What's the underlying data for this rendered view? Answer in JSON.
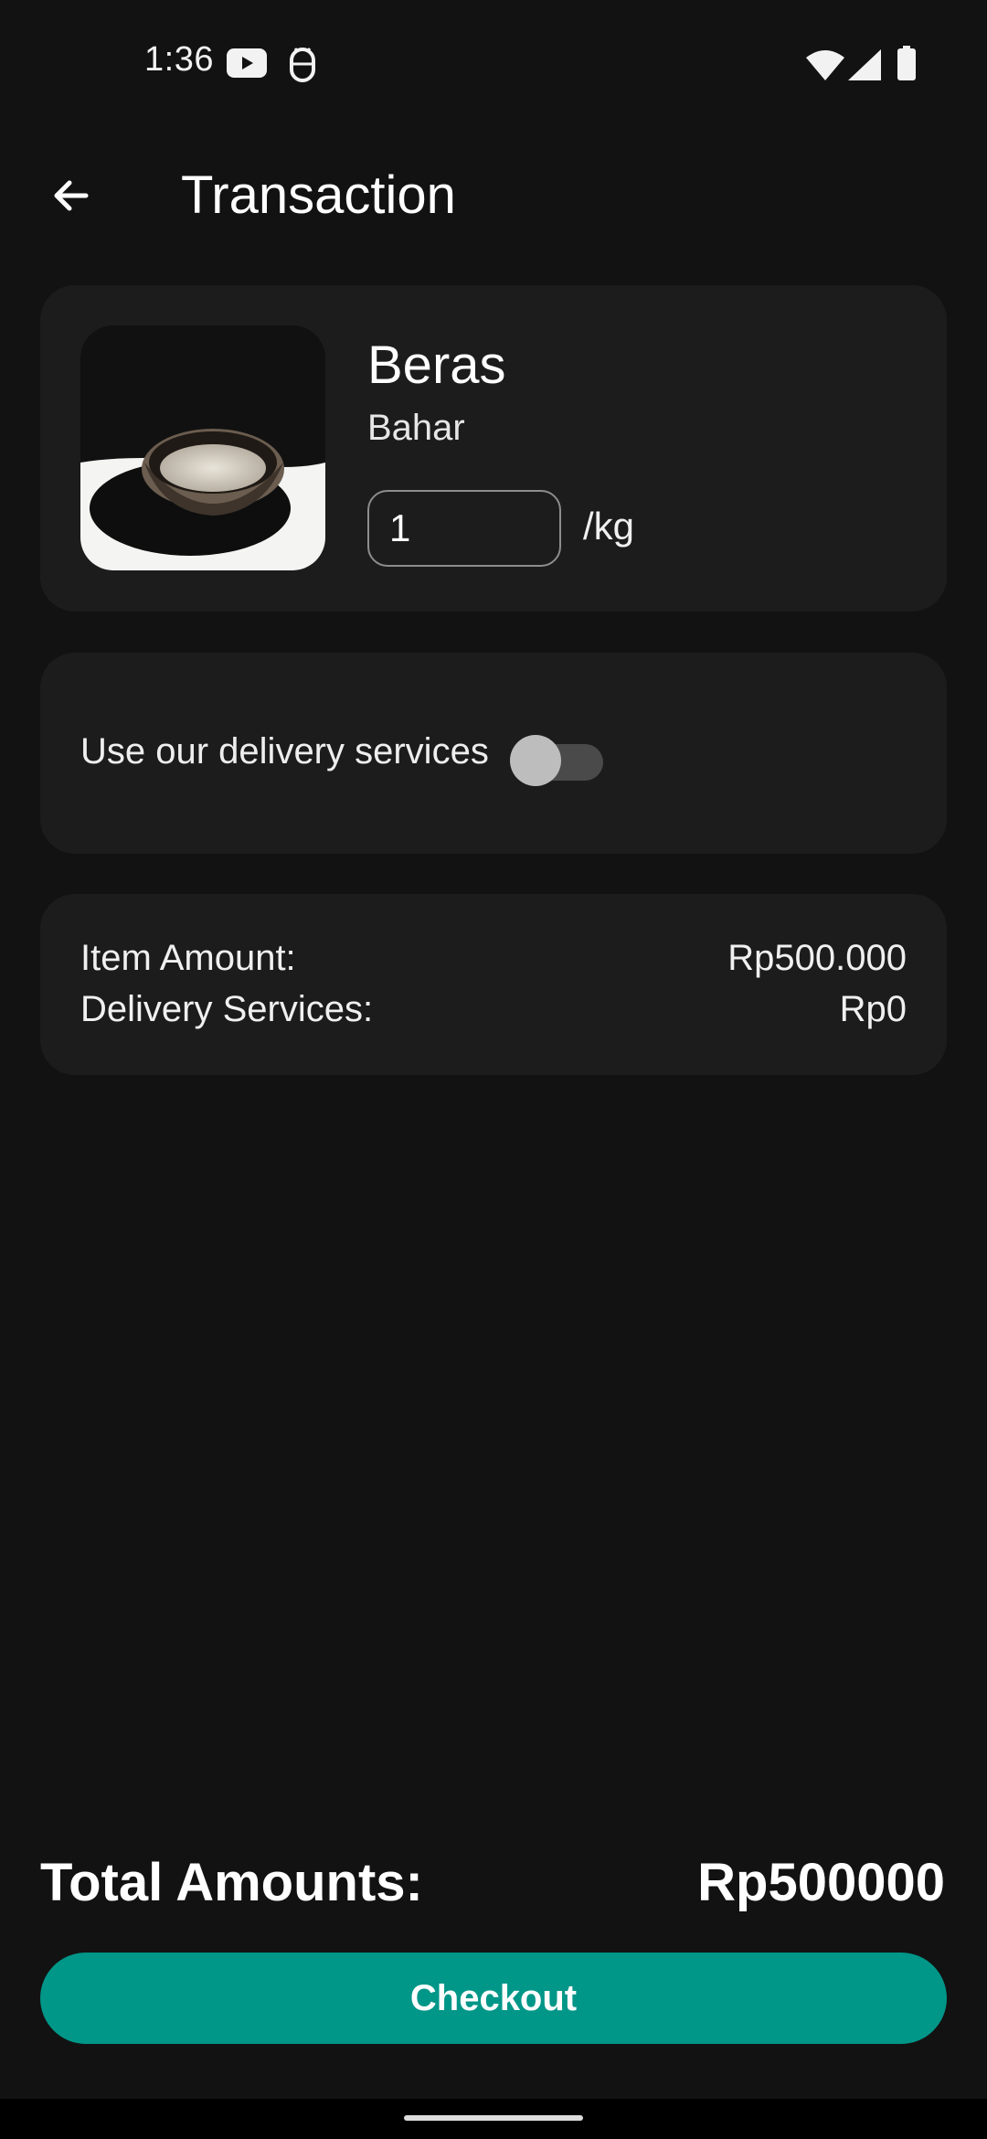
{
  "status_bar": {
    "time": "1:36",
    "icons_left": [
      "youtube-icon",
      "android-debug-icon"
    ],
    "icons_right": [
      "wifi-icon",
      "cellular-signal-icon",
      "battery-icon"
    ]
  },
  "app_bar": {
    "back_icon": "arrow-back-icon",
    "title": "Transaction"
  },
  "product": {
    "name": "Beras",
    "seller": "Bahar",
    "quantity": "1",
    "unit": "/kg"
  },
  "delivery": {
    "label": "Use our delivery services",
    "enabled": false
  },
  "summary": {
    "item_amount_label": "Item Amount:",
    "item_amount_value": "Rp500.000",
    "delivery_label": "Delivery Services:",
    "delivery_value": "Rp0"
  },
  "footer": {
    "total_label": "Total Amounts:",
    "total_value": "Rp500000",
    "checkout_label": "Checkout"
  },
  "colors": {
    "background": "#121212",
    "card": "#1c1c1c",
    "accent": "#009688"
  }
}
